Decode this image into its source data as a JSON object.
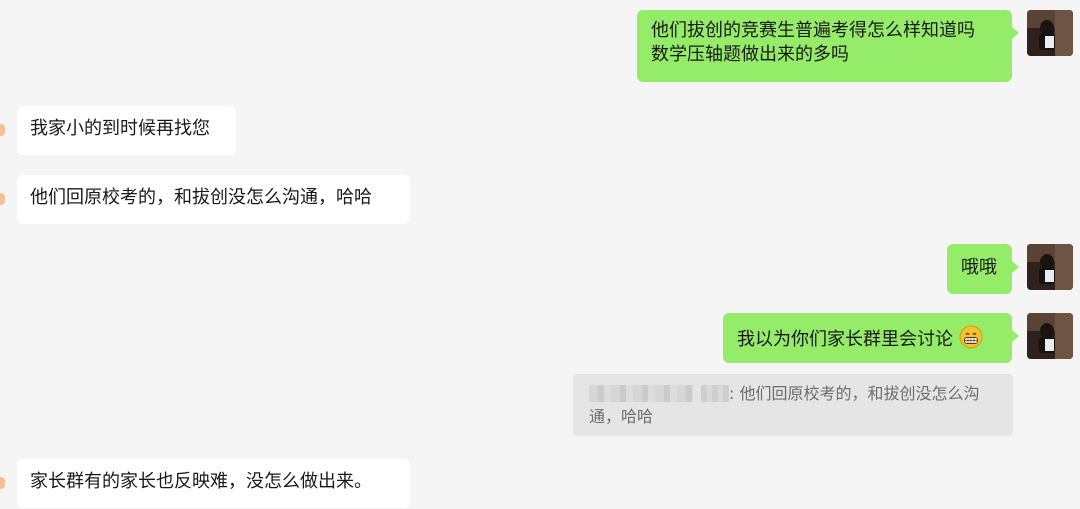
{
  "messages": [
    {
      "from": "me",
      "lines": [
        "他们拔创的竞赛生普遍考得怎么样知道吗",
        "数学压轴题做出来的多吗"
      ]
    },
    {
      "from": "them",
      "text": "我家小的到时候再找您"
    },
    {
      "from": "them",
      "text": "他们回原校考的，和拔创没怎么沟通，哈哈"
    },
    {
      "from": "me",
      "text": "哦哦"
    },
    {
      "from": "me",
      "text": "我以为你们家长群里会讨论",
      "emoji": "grinning-face-emoji"
    },
    {
      "from": "them",
      "text": "家长群有的家长也反映难，没怎么做出来。"
    }
  ],
  "quote": {
    "line1": ": 他们回原校考的，和拔创没怎么沟",
    "line2": "通，哈哈"
  },
  "colors": {
    "background": "#f5f5f5",
    "sent_bubble": "#95ec69",
    "received_bubble": "#ffffff",
    "quote_bg": "#e5e5e5"
  }
}
